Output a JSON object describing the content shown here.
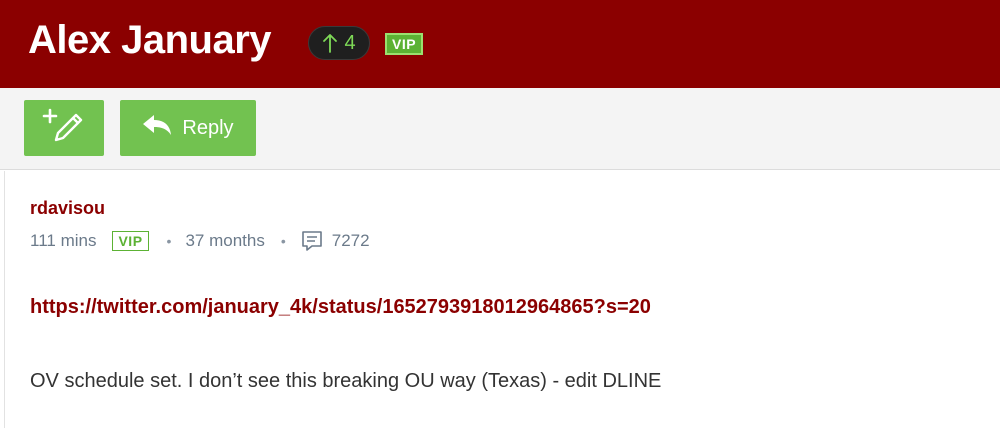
{
  "header": {
    "title": "Alex January",
    "upvote_count": "4",
    "vip_badge": "VIP",
    "background_color": "#8b0000"
  },
  "toolbar": {
    "new_post_icon": "pencil-plus-icon",
    "reply_label": "Reply",
    "button_color": "#72c250"
  },
  "post": {
    "author": "rdavisou",
    "time_ago": "111 mins",
    "vip_badge": "VIP",
    "member_duration": "37 months",
    "comment_count": "7272",
    "link_text": "https://twitter.com/january_4k/status/1652793918012964865?s=20",
    "body": "OV schedule set. I don’t see this breaking OU way (Texas) - edit DLINE"
  }
}
